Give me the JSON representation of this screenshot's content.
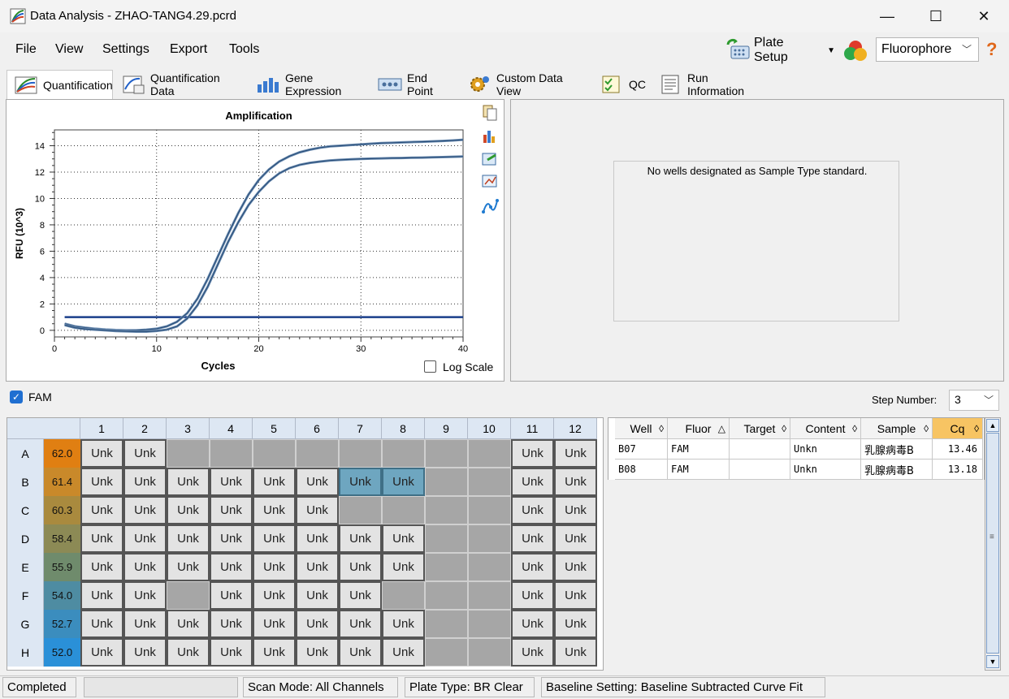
{
  "window": {
    "title": "Data Analysis - ZHAO-TANG4.29.pcrd",
    "minimize_glyph": "—",
    "maximize_glyph": "☐",
    "close_glyph": "✕"
  },
  "menu": {
    "file": "File",
    "view": "View",
    "settings": "Settings",
    "export": "Export",
    "tools": "Tools"
  },
  "toolbar": {
    "plate_setup": "Plate Setup",
    "fluorophore": "Fluorophore",
    "help_glyph": "?"
  },
  "tabs": [
    {
      "label": "Quantification",
      "icon": "amplification-curves-icon",
      "active": true
    },
    {
      "label": "Quantification Data",
      "icon": "data-sheet-icon",
      "active": false
    },
    {
      "label": "Gene Expression",
      "icon": "bar-chart-icon",
      "active": false
    },
    {
      "label": "End Point",
      "icon": "dots-icon",
      "active": false
    },
    {
      "label": "Custom Data View",
      "icon": "gear-icon",
      "active": false
    },
    {
      "label": "QC",
      "icon": "checklist-icon",
      "active": false
    },
    {
      "label": "Run Information",
      "icon": "document-icon",
      "active": false
    }
  ],
  "chart_data": {
    "type": "line",
    "title": "Amplification",
    "xlabel": "Cycles",
    "ylabel": "RFU (10^3)",
    "xlim": [
      0,
      40
    ],
    "ylim": [
      -0.5,
      15.2
    ],
    "xticks": [
      0,
      10,
      20,
      30,
      40
    ],
    "yticks": [
      0,
      2,
      4,
      6,
      8,
      10,
      12,
      14
    ],
    "grid": true,
    "threshold": 1.0,
    "series": [
      {
        "x": [
          1,
          2,
          3,
          4,
          5,
          6,
          7,
          8,
          9,
          10,
          11,
          12,
          13,
          14,
          15,
          16,
          17,
          18,
          19,
          20,
          21,
          22,
          23,
          24,
          25,
          26,
          27,
          28,
          29,
          30,
          31,
          32,
          33,
          34,
          35,
          36,
          37,
          38,
          39,
          40
        ],
        "values": [
          0.5,
          0.3,
          0.2,
          0.12,
          0.06,
          0.02,
          0.0,
          0.0,
          0.05,
          0.12,
          0.3,
          0.65,
          1.3,
          2.4,
          3.9,
          5.6,
          7.3,
          8.9,
          10.3,
          11.4,
          12.2,
          12.8,
          13.2,
          13.5,
          13.7,
          13.85,
          13.95,
          14.0,
          14.05,
          14.1,
          14.15,
          14.2,
          14.22,
          14.25,
          14.28,
          14.3,
          14.33,
          14.36,
          14.4,
          14.45
        ]
      },
      {
        "x": [
          1,
          2,
          3,
          4,
          5,
          6,
          7,
          8,
          9,
          10,
          11,
          12,
          13,
          14,
          15,
          16,
          17,
          18,
          19,
          20,
          21,
          22,
          23,
          24,
          25,
          26,
          27,
          28,
          29,
          30,
          31,
          32,
          33,
          34,
          35,
          36,
          37,
          38,
          39,
          40
        ],
        "values": [
          0.4,
          0.2,
          0.1,
          0.05,
          0.0,
          -0.05,
          -0.08,
          -0.1,
          -0.1,
          -0.05,
          0.05,
          0.3,
          0.9,
          1.9,
          3.3,
          5.0,
          6.7,
          8.2,
          9.5,
          10.5,
          11.3,
          11.9,
          12.3,
          12.55,
          12.7,
          12.8,
          12.88,
          12.93,
          12.97,
          13.0,
          13.02,
          13.04,
          13.06,
          13.07,
          13.09,
          13.1,
          13.12,
          13.14,
          13.16,
          13.18
        ]
      }
    ],
    "log_scale_label": "Log Scale",
    "log_scale_checked": false
  },
  "standard_panel": {
    "message": "No wells designated as Sample Type standard."
  },
  "filter": {
    "fam_label": "FAM",
    "fam_checked": true,
    "step_label": "Step Number:",
    "step_value": "3"
  },
  "plate": {
    "columns": [
      "1",
      "2",
      "3",
      "4",
      "5",
      "6",
      "7",
      "8",
      "9",
      "10",
      "11",
      "12"
    ],
    "rows": [
      {
        "label": "A",
        "temp": "62.0",
        "temp_color": "#e07f12",
        "wells": [
          "Unk",
          "Unk",
          "",
          "",
          "",
          "",
          "",
          "",
          "",
          "",
          "Unk",
          "Unk"
        ]
      },
      {
        "label": "B",
        "temp": "61.4",
        "temp_color": "#c9892a",
        "wells": [
          "Unk",
          "Unk",
          "Unk",
          "Unk",
          "Unk",
          "Unk",
          "Unk*",
          "Unk*",
          "",
          "",
          "Unk",
          "Unk"
        ]
      },
      {
        "label": "C",
        "temp": "60.3",
        "temp_color": "#a98a3e",
        "wells": [
          "Unk",
          "Unk",
          "Unk",
          "Unk",
          "Unk",
          "Unk",
          "",
          "",
          "",
          "",
          "Unk",
          "Unk"
        ]
      },
      {
        "label": "D",
        "temp": "58.4",
        "temp_color": "#8c8a55",
        "wells": [
          "Unk",
          "Unk",
          "Unk",
          "Unk",
          "Unk",
          "Unk",
          "Unk",
          "Unk",
          "",
          "",
          "Unk",
          "Unk"
        ]
      },
      {
        "label": "E",
        "temp": "55.9",
        "temp_color": "#6f8b6c",
        "wells": [
          "Unk",
          "Unk",
          "Unk",
          "Unk",
          "Unk",
          "Unk",
          "Unk",
          "Unk",
          "",
          "",
          "Unk",
          "Unk"
        ]
      },
      {
        "label": "F",
        "temp": "54.0",
        "temp_color": "#4e8ca2",
        "wells": [
          "Unk",
          "Unk",
          "",
          "Unk",
          "Unk",
          "Unk",
          "Unk",
          "",
          "",
          "",
          "Unk",
          "Unk"
        ]
      },
      {
        "label": "G",
        "temp": "52.7",
        "temp_color": "#3b8dbe",
        "wells": [
          "Unk",
          "Unk",
          "Unk",
          "Unk",
          "Unk",
          "Unk",
          "Unk",
          "Unk",
          "",
          "",
          "Unk",
          "Unk"
        ]
      },
      {
        "label": "H",
        "temp": "52.0",
        "temp_color": "#2a90d8",
        "wells": [
          "Unk",
          "Unk",
          "Unk",
          "Unk",
          "Unk",
          "Unk",
          "Unk",
          "Unk",
          "",
          "",
          "Unk",
          "Unk"
        ]
      }
    ]
  },
  "results": {
    "headers": [
      "Well",
      "Fluor",
      "Target",
      "Content",
      "Sample",
      "Cq"
    ],
    "rows": [
      [
        "B07",
        "FAM",
        "",
        "Unkn",
        "乳腺病毒B",
        "13.46"
      ],
      [
        "B08",
        "FAM",
        "",
        "Unkn",
        "乳腺病毒B",
        "13.18"
      ]
    ]
  },
  "status": {
    "state": "Completed",
    "scan_mode": "Scan Mode: All Channels",
    "plate_type": "Plate Type: BR Clear",
    "baseline": "Baseline Setting: Baseline Subtracted Curve Fit"
  }
}
